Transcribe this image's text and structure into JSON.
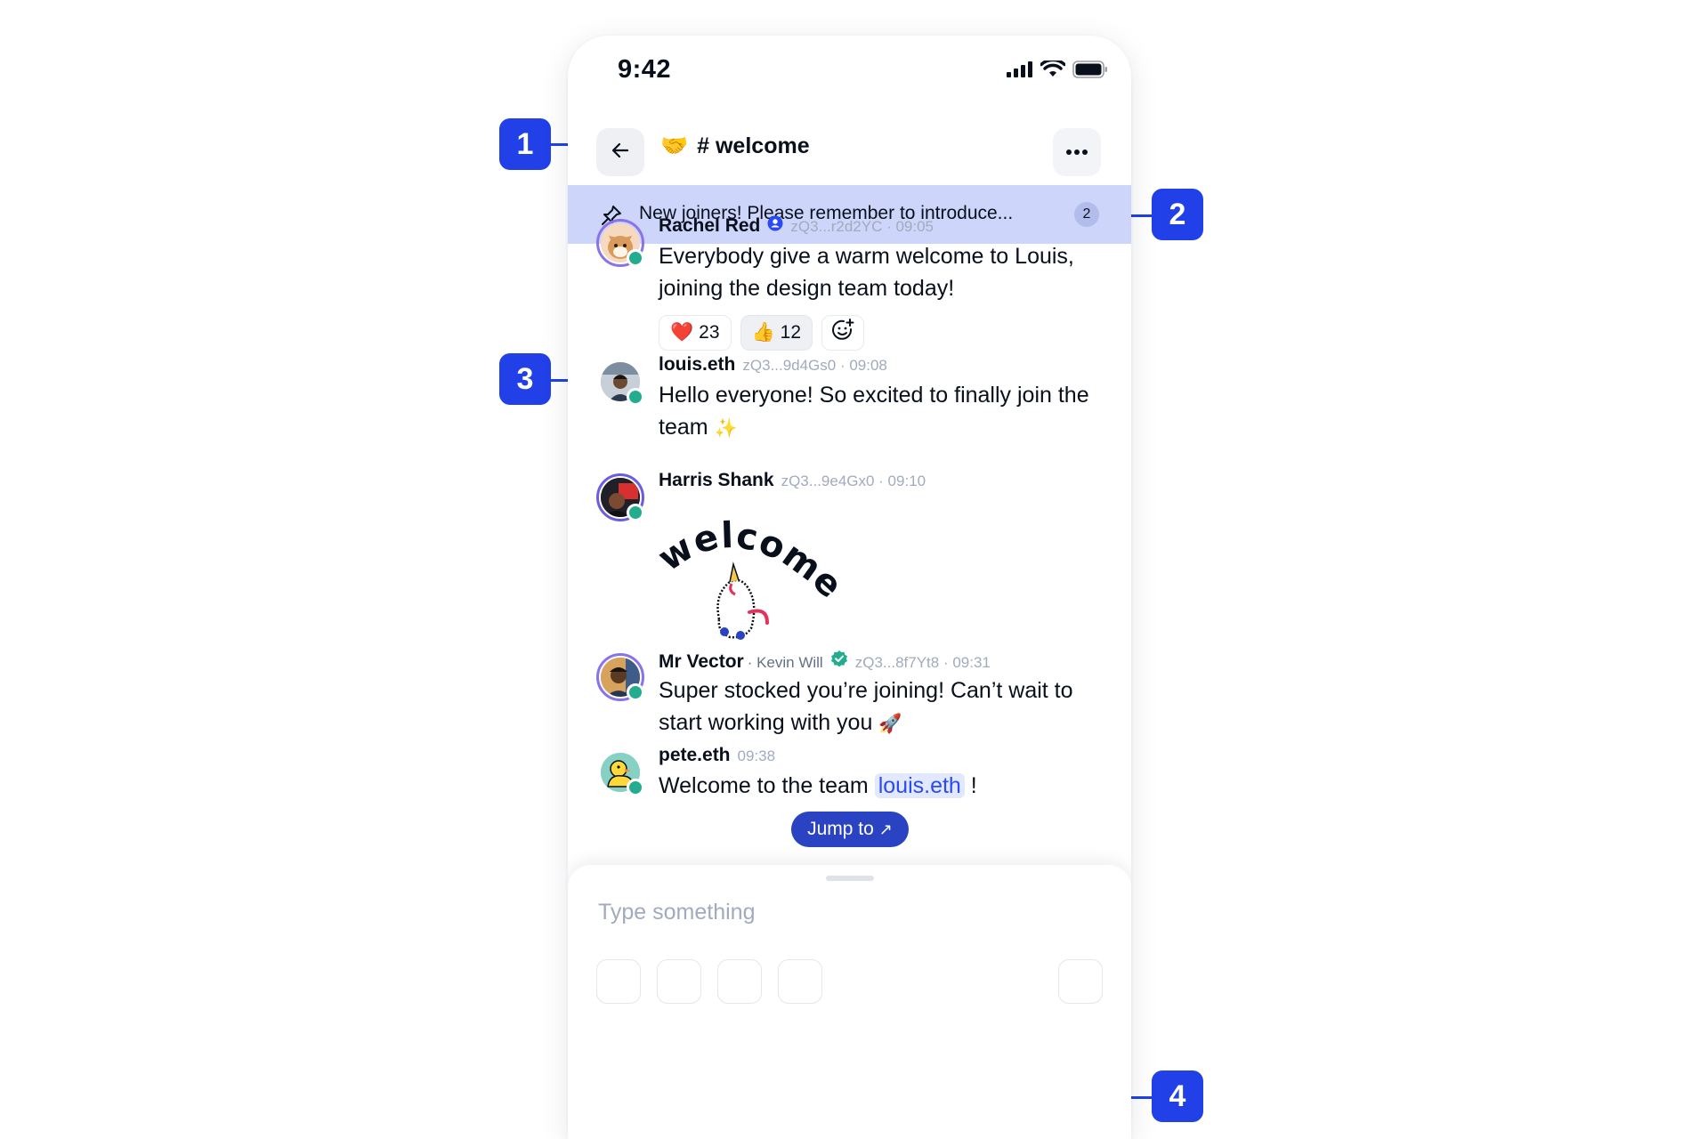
{
  "status_bar": {
    "time": "9:42"
  },
  "header": {
    "channel_emoji": "🤝",
    "channel_name": "# welcome"
  },
  "pinned": {
    "text": "New joiners! Please remember to introduce...",
    "count": "2"
  },
  "messages": [
    {
      "author": "Rachel Red",
      "id_time": "zQ3...r2d2YC · 09:05",
      "text": "Everybody give a warm welcome to Louis, joining the design team today!"
    },
    {
      "author": "louis.eth",
      "id_time": "zQ3...9d4Gs0 · 09:08",
      "text": "Hello everyone! So excited to finally join the team",
      "emoji": "✨"
    },
    {
      "author": "Harris Shank",
      "id_time": "zQ3...9e4Gx0 · 09:10",
      "sticker_text": "welcome!"
    },
    {
      "author": "Mr Vector",
      "nickname": "· Kevin Will",
      "id_time": "zQ3...8f7Yt8 · 09:31",
      "text": "Super stocked you’re joining! Can’t wait to start working with you",
      "emoji": "🚀"
    },
    {
      "author": "pete.eth",
      "id_time": "09:38",
      "text_before": "Welcome to the team ",
      "mention": "louis.eth",
      "text_after": " !"
    }
  ],
  "reactions": [
    {
      "emoji": "❤️",
      "count": "23"
    },
    {
      "emoji": "👍",
      "count": "12"
    }
  ],
  "jump_button": {
    "label": "Jump to",
    "arrow": "↗"
  },
  "composer": {
    "placeholder": "Type something"
  },
  "callouts": [
    "1",
    "2",
    "3",
    "4"
  ],
  "colors": {
    "accent": "#2140e8",
    "pinned_bg": "#cdd5fa",
    "online": "#23ad8f",
    "jump_bg": "#2a43c2"
  }
}
